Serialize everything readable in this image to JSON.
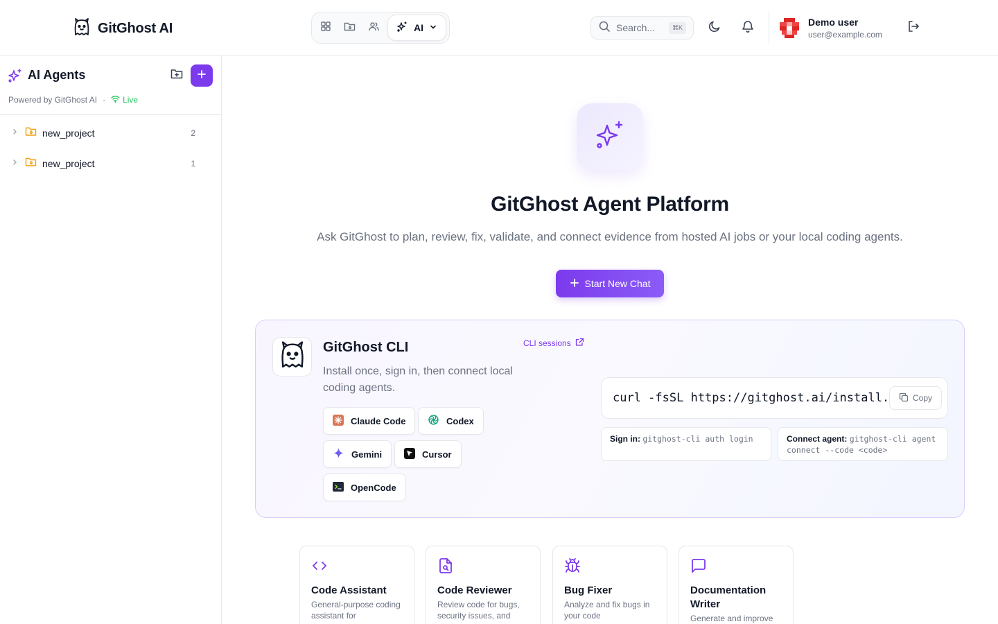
{
  "header": {
    "brand": "GitGhost AI",
    "nav_active_label": "AI",
    "search_placeholder": "Search...",
    "search_shortcut": "⌘K",
    "user_name": "Demo user",
    "user_email": "user@example.com"
  },
  "sidebar": {
    "title": "AI Agents",
    "powered_by": "Powered by GitGhost AI",
    "separator": "·",
    "status": "Live",
    "items": [
      {
        "label": "new_project",
        "count": "2"
      },
      {
        "label": "new_project",
        "count": "1"
      }
    ]
  },
  "main": {
    "title": "GitGhost Agent Platform",
    "subtitle": "Ask GitGhost to plan, review, fix, validate, and connect evidence from hosted AI jobs or your local coding agents.",
    "start_button": "Start New Chat",
    "cli": {
      "title": "GitGhost CLI",
      "description": "Install once, sign in, then connect local coding agents.",
      "sessions_link": "CLI sessions",
      "agents": [
        "Claude Code",
        "Codex",
        "Gemini",
        "Cursor",
        "OpenCode"
      ],
      "command": "curl -fsSL https://gitghost.ai/install.sh | sh",
      "copy_label": "Copy",
      "sign_in_label": "Sign in:",
      "sign_in_cmd": "gitghost-cli auth login",
      "connect_label": "Connect agent:",
      "connect_cmd": "gitghost-cli agent connect --code <code>"
    },
    "features": [
      {
        "title": "Code Assistant",
        "desc": "General-purpose coding assistant for"
      },
      {
        "title": "Code Reviewer",
        "desc": "Review code for bugs, security issues, and"
      },
      {
        "title": "Bug Fixer",
        "desc": "Analyze and fix bugs in your code"
      },
      {
        "title": "Documentation Writer",
        "desc": "Generate and improve"
      }
    ]
  },
  "colors": {
    "accent": "#7c3aed",
    "live": "#22c55e",
    "folder": "#f59e0b",
    "border": "#e5e7eb"
  }
}
